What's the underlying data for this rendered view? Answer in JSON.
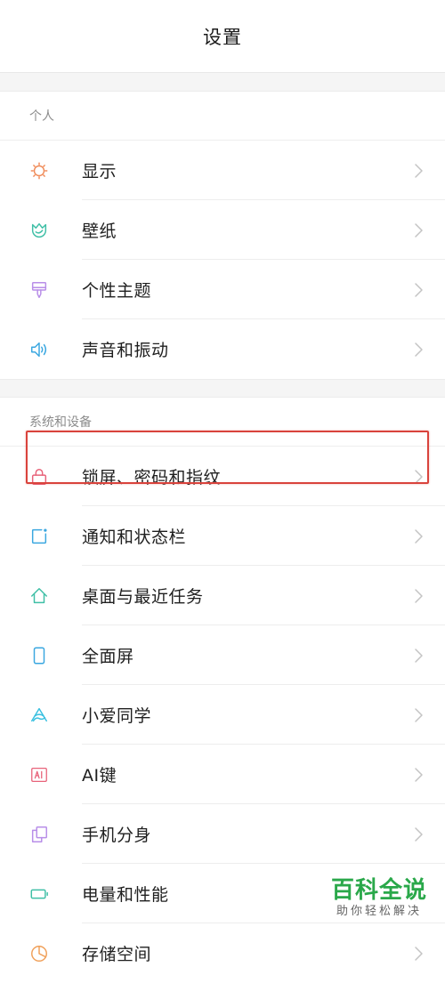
{
  "header": {
    "title": "设置"
  },
  "sections": [
    {
      "title": "个人",
      "items": [
        {
          "label": "显示",
          "icon": "sun-icon",
          "color": "#f08c5a"
        },
        {
          "label": "壁纸",
          "icon": "tulip-icon",
          "color": "#3fbfa6"
        },
        {
          "label": "个性主题",
          "icon": "brush-icon",
          "color": "#b88ee8"
        },
        {
          "label": "声音和振动",
          "icon": "speaker-icon",
          "color": "#3aa7e0"
        }
      ]
    },
    {
      "title": "系统和设备",
      "items": [
        {
          "label": "锁屏、密码和指纹",
          "icon": "lock-icon",
          "color": "#e8637a"
        },
        {
          "label": "通知和状态栏",
          "icon": "notification-icon",
          "color": "#3aa7e0"
        },
        {
          "label": "桌面与最近任务",
          "icon": "home-icon",
          "color": "#3fbfa6"
        },
        {
          "label": "全面屏",
          "icon": "phone-icon",
          "color": "#3aa7e0"
        },
        {
          "label": "小爱同学",
          "icon": "assistant-icon",
          "color": "#3ac0e0"
        },
        {
          "label": "AI键",
          "icon": "ai-key-icon",
          "color": "#e8637a"
        },
        {
          "label": "手机分身",
          "icon": "clone-icon",
          "color": "#b88ee8"
        },
        {
          "label": "电量和性能",
          "icon": "battery-icon",
          "color": "#3fbfa6"
        },
        {
          "label": "存储空间",
          "icon": "storage-icon",
          "color": "#f0a05a"
        }
      ]
    }
  ],
  "highlight": {
    "label": "锁屏、密码和指纹",
    "color": "#d9433c"
  },
  "watermark": {
    "main": "百科全说",
    "sub": "助你轻松解决"
  }
}
